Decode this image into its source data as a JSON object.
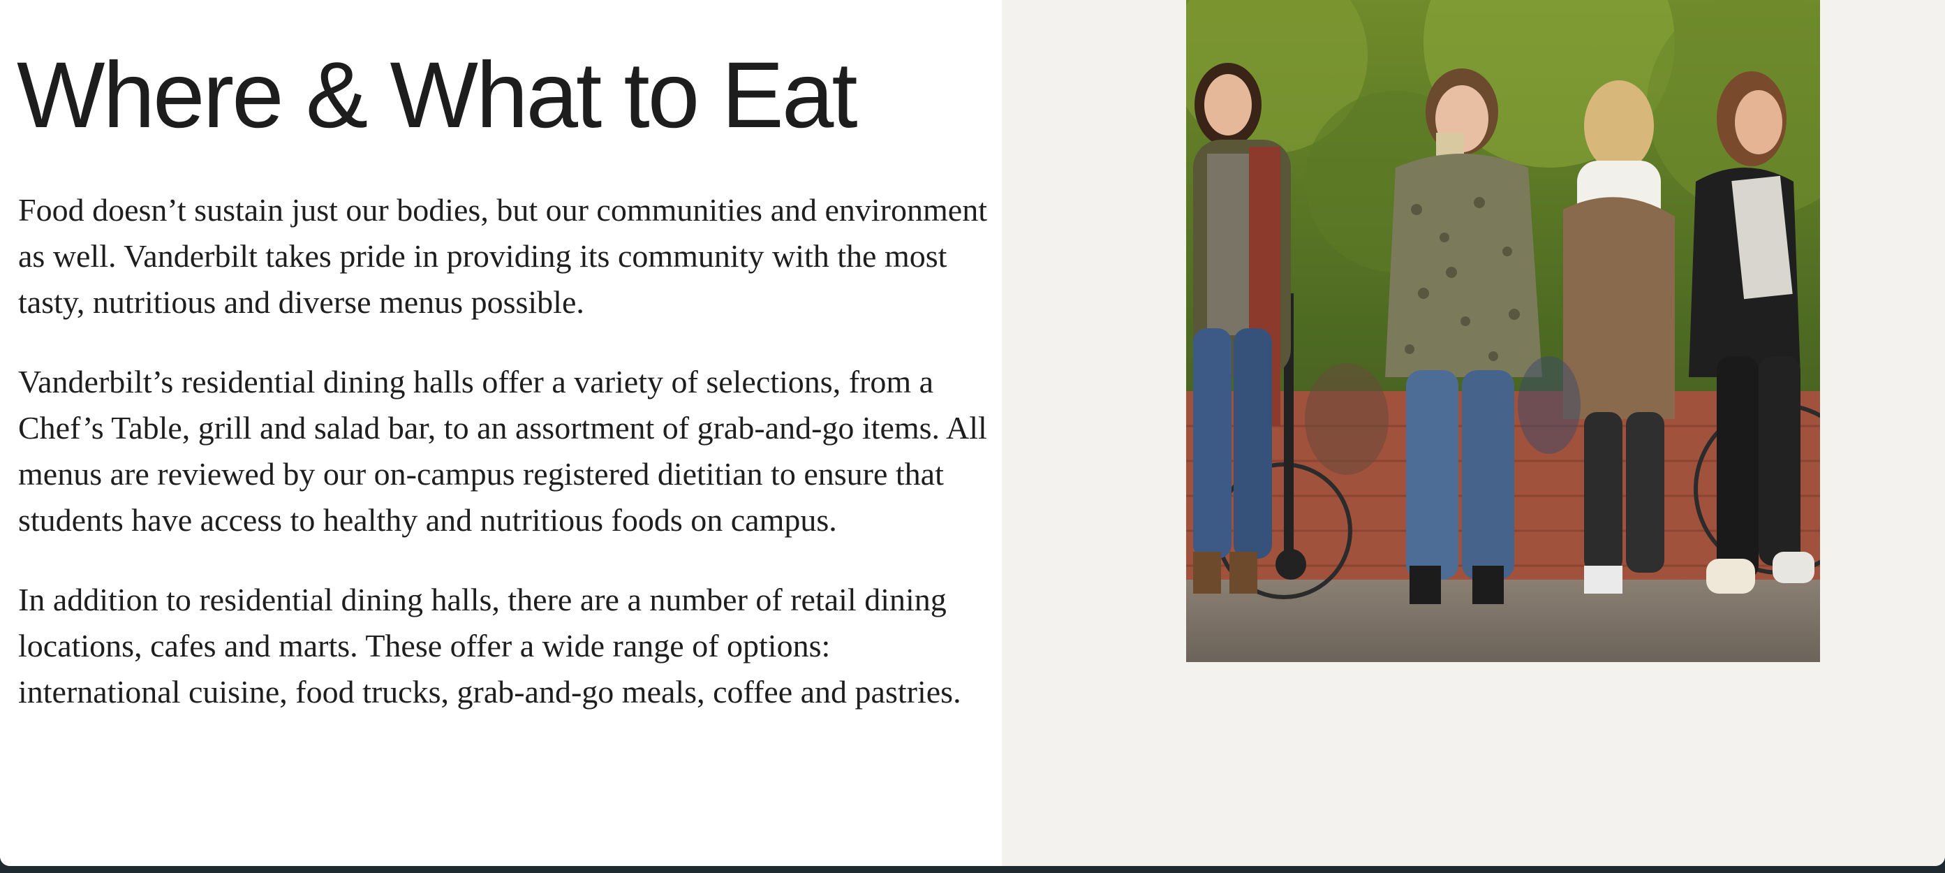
{
  "article": {
    "title": "Where & What to Eat",
    "paragraphs": [
      "Food doesn’t sustain just our bodies, but our communities and environment as well. Vanderbilt takes pride in providing its community with the most tasty, nutritious and diverse menus possible.",
      "Vanderbilt’s residential dining halls offer a variety of selections, from a Chef’s Table, grill and salad bar, to an assortment of grab-and-go items. All menus are reviewed by our on-campus registered dietitian to ensure that students have access to healthy and nutritious foods on campus.",
      "In addition to residential dining halls, there are a number of retail dining locations, cafes and marts. These offer a wide range of options: international cuisine, food trucks, grab-and-go meals, coffee and pastries."
    ]
  },
  "colors": {
    "text": "#1e1e1e",
    "right_panel_bg": "#f3f2ef",
    "page_bg": "#ffffff"
  },
  "photo": {
    "subject": "students-walking-on-campus"
  }
}
